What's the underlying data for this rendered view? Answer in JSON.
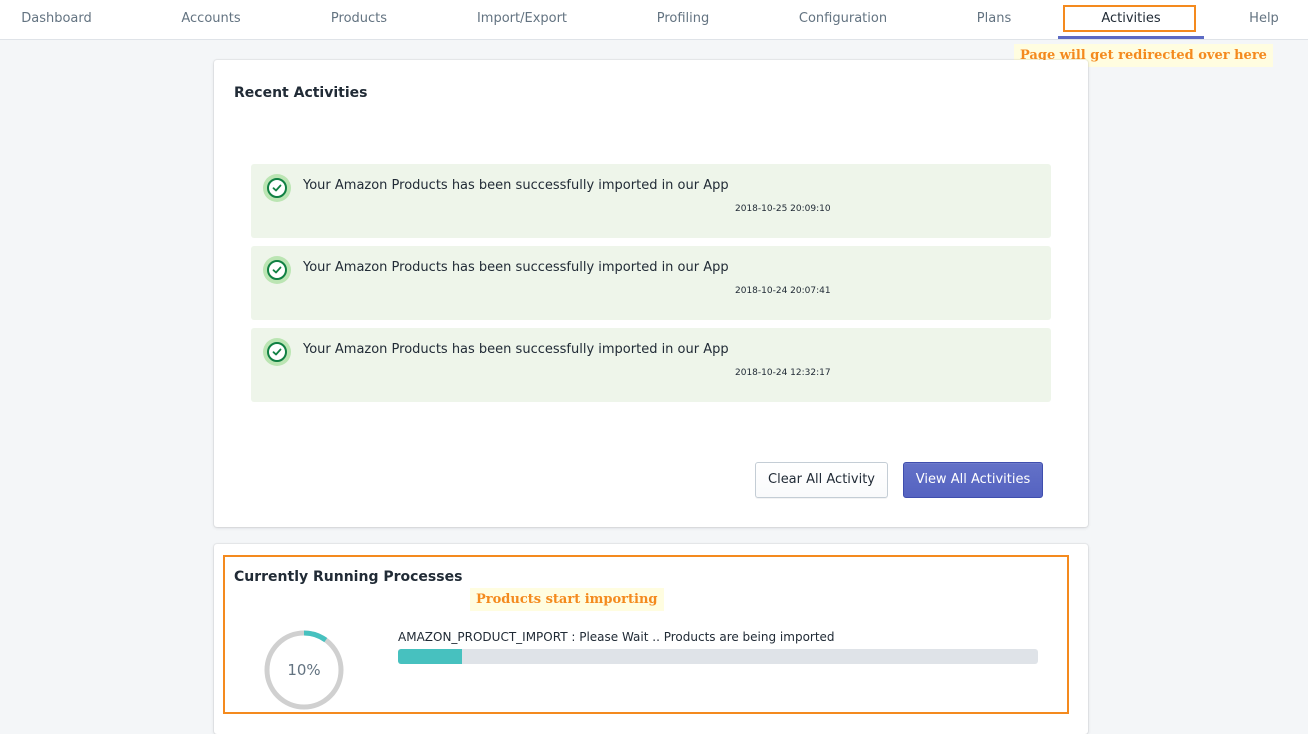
{
  "nav": {
    "items": [
      {
        "label": "Dashboard"
      },
      {
        "label": "Accounts"
      },
      {
        "label": "Products"
      },
      {
        "label": "Import/Export"
      },
      {
        "label": "Profiling"
      },
      {
        "label": "Configuration"
      },
      {
        "label": "Plans"
      },
      {
        "label": "Activities"
      },
      {
        "label": "Help"
      }
    ],
    "active": "Activities"
  },
  "annotations": {
    "redirect_note": "Page will get redirected over here",
    "import_note": "Products start importing"
  },
  "recent_activities": {
    "title": "Recent Activities",
    "items": [
      {
        "message": "Your Amazon Products has been successfully imported in our App",
        "timestamp": "2018-10-25 20:09:10",
        "icon": "check-circle-icon"
      },
      {
        "message": "Your Amazon Products has been successfully imported in our App",
        "timestamp": "2018-10-24 20:07:41",
        "icon": "check-circle-icon"
      },
      {
        "message": "Your Amazon Products has been successfully imported in our App",
        "timestamp": "2018-10-24 12:32:17",
        "icon": "check-circle-icon"
      }
    ],
    "clear_label": "Clear All Activity",
    "view_label": "View All Activities"
  },
  "running_processes": {
    "title": "Currently Running Processes",
    "process_label": "AMAZON_PRODUCT_IMPORT : Please Wait .. Products are being imported",
    "progress_percent": 10,
    "progress_text": "10%"
  },
  "colors": {
    "accent": "#5c6ac4",
    "annotation": "#f48a1e",
    "success_bg": "#eef5ea",
    "success_icon": "#108043",
    "progress": "#47c1bf"
  }
}
